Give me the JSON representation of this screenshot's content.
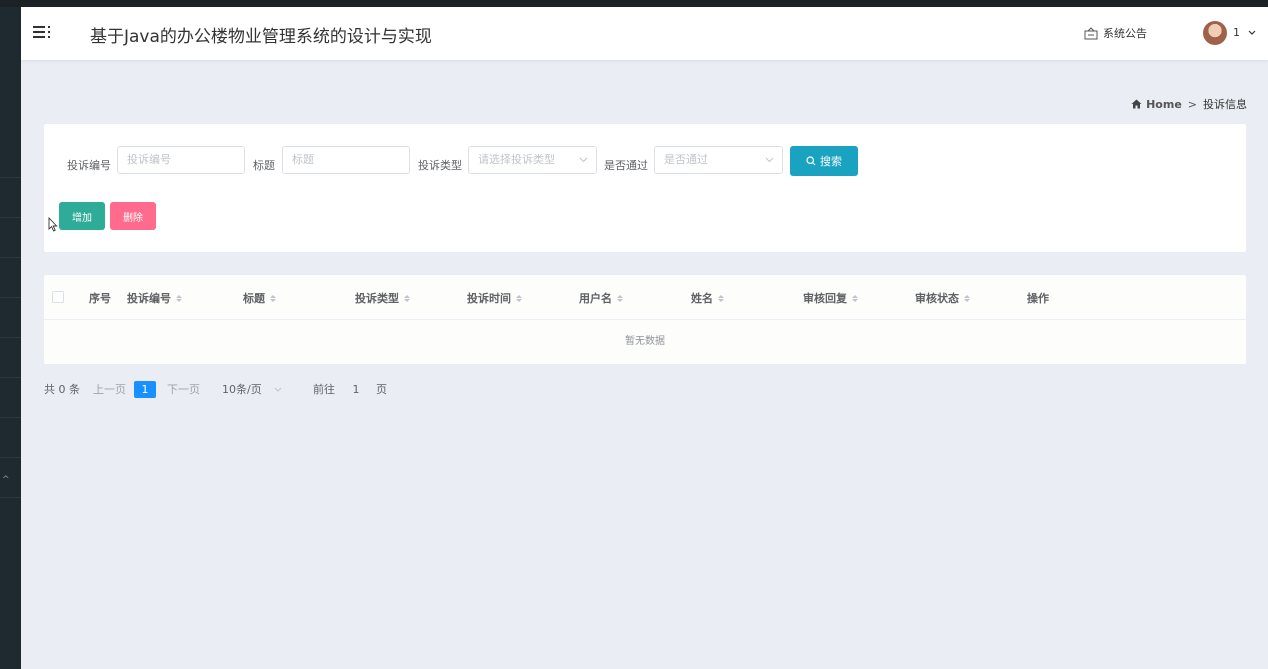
{
  "header": {
    "title": "基于Java的办公楼物业管理系统的设计与实现",
    "notice_label": "系统公告",
    "username": "1"
  },
  "breadcrumb": {
    "home": "Home",
    "separator": ">",
    "current": "投诉信息"
  },
  "search": {
    "fields": [
      {
        "label": "投诉编号",
        "placeholder": "投诉编号"
      },
      {
        "label": "标题",
        "placeholder": "标题"
      },
      {
        "label": "投诉类型",
        "placeholder": "请选择投诉类型"
      },
      {
        "label": "是否通过",
        "placeholder": "是否通过"
      }
    ],
    "search_button": "搜索",
    "add_button": "增加",
    "delete_button": "删除"
  },
  "table": {
    "columns": [
      "序号",
      "投诉编号",
      "标题",
      "投诉类型",
      "投诉时间",
      "用户名",
      "姓名",
      "审核回复",
      "审核状态",
      "操作"
    ],
    "empty_text": "暂无数据"
  },
  "pagination": {
    "total": "共 0 条",
    "prev": "上一页",
    "current_page": "1",
    "next": "下一页",
    "page_size": "10条/页",
    "goto_prefix": "前往",
    "goto_value": "1",
    "goto_suffix": "页"
  },
  "colors": {
    "search_button": "#1aa3c1",
    "add_button": "#2eac98",
    "delete_button": "#ff6b8c",
    "active_page": "#1890ff"
  }
}
